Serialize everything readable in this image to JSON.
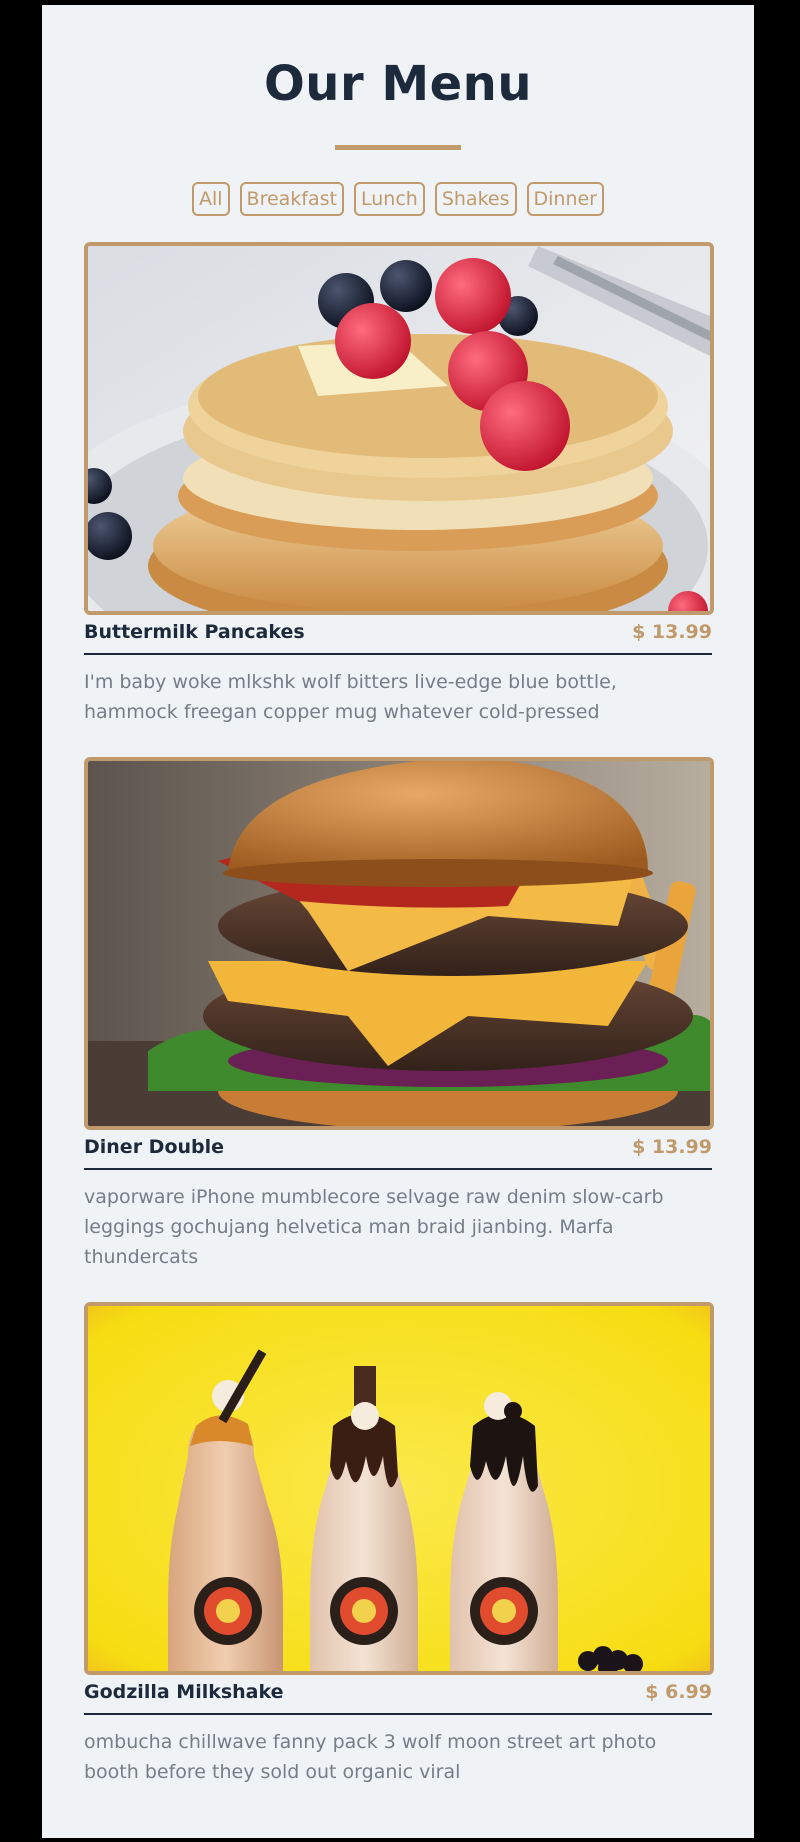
{
  "page": {
    "title": "Our Menu"
  },
  "filters": [
    {
      "label": "All"
    },
    {
      "label": "Breakfast"
    },
    {
      "label": "Lunch"
    },
    {
      "label": "Shakes"
    },
    {
      "label": "Dinner"
    }
  ],
  "items": [
    {
      "name": "Buttermilk Pancakes",
      "price": "$ 13.99",
      "description": "I'm baby woke mlkshk wolf bitters live-edge blue bottle, hammock freegan copper mug whatever cold-pressed",
      "image": "pancakes-photo"
    },
    {
      "name": "Diner Double",
      "price": "$ 13.99",
      "description": "vaporware iPhone mumblecore selvage raw denim slow-carb leggings gochujang helvetica man braid jianbing. Marfa thundercats",
      "image": "burger-photo"
    },
    {
      "name": "Godzilla Milkshake",
      "price": "$ 6.99",
      "description": "ombucha chillwave fanny pack 3 wolf moon street art photo booth before they sold out organic viral",
      "image": "milkshake-photo"
    }
  ],
  "colors": {
    "accent": "#c09a6b",
    "heading": "#1c2a3b",
    "text": "#757d86",
    "background": "#f0f3f6"
  }
}
